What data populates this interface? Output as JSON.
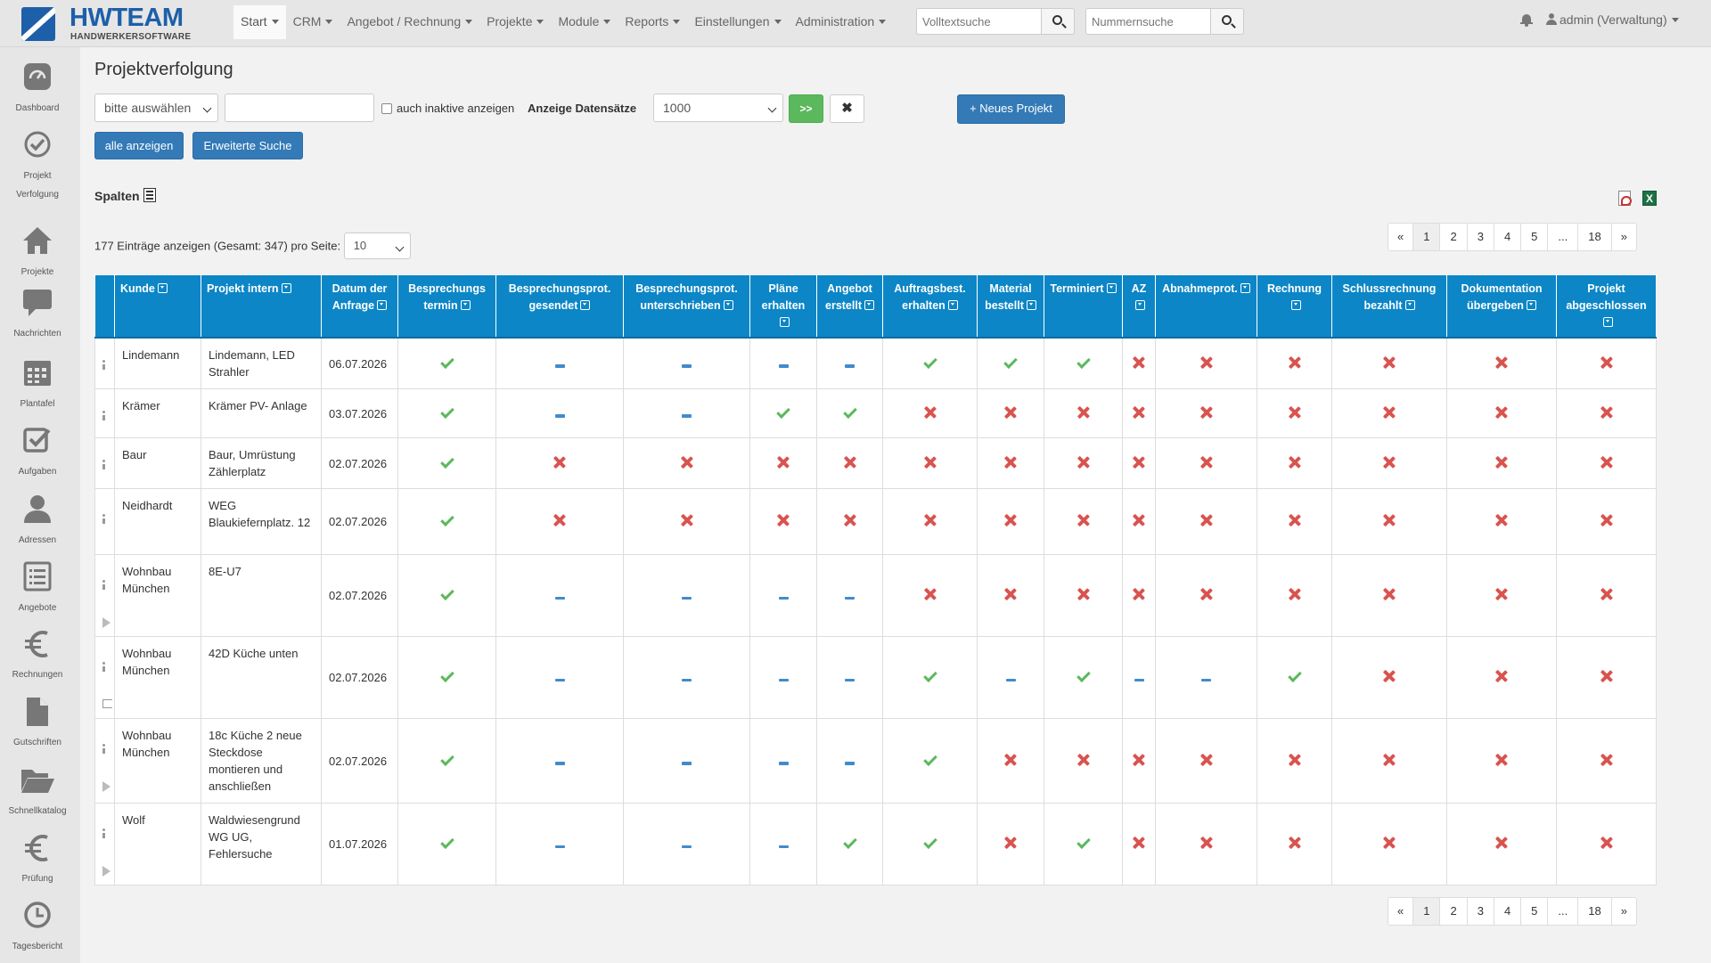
{
  "brand": {
    "name": "HWTEAM",
    "tagline": "HANDWERKERSOFTWARE"
  },
  "nav": [
    {
      "label": "Start",
      "active": true
    },
    {
      "label": "CRM"
    },
    {
      "label": "Angebot / Rechnung"
    },
    {
      "label": "Projekte"
    },
    {
      "label": "Module"
    },
    {
      "label": "Reports"
    },
    {
      "label": "Einstellungen"
    },
    {
      "label": "Administration"
    }
  ],
  "search": {
    "fulltext_placeholder": "Volltextsuche",
    "number_placeholder": "Nummernsuche"
  },
  "user": {
    "label": "admin (Verwaltung)"
  },
  "sidebar": [
    {
      "label": "Dashboard",
      "icon": "dashboard-icon"
    },
    {
      "label": "Projekt",
      "label2": "Verfolgung",
      "icon": "check-circle-icon"
    },
    {
      "label": "Projekte",
      "icon": "home-icon"
    },
    {
      "label": "Nachrichten",
      "icon": "comment-icon"
    },
    {
      "label": "Plantafel",
      "icon": "calendar-icon"
    },
    {
      "label": "Aufgaben",
      "icon": "checkbox-icon"
    },
    {
      "label": "Adressen",
      "icon": "user-icon"
    },
    {
      "label": "Angebote",
      "icon": "list-icon"
    },
    {
      "label": "Rechnungen",
      "icon": "euro-icon"
    },
    {
      "label": "Gutschriften",
      "icon": "file-icon"
    },
    {
      "label": "Schnellkatalog",
      "icon": "folder-open-icon"
    },
    {
      "label": "Prüfung",
      "icon": "euro-icon"
    },
    {
      "label": "Tagesbericht",
      "icon": "clock-icon"
    }
  ],
  "page": {
    "title": "Projektverfolgung",
    "filter_select": "bitte auswählen",
    "inactive_label": "auch inaktive anzeigen",
    "records_label": "Anzeige Datensätze",
    "records_value": "1000",
    "go_label": ">>",
    "clear_label": "✖",
    "new_project_label": "+ Neues Projekt",
    "show_all_label": "alle anzeigen",
    "advanced_search_label": "Erweiterte Suche",
    "columns_label": "Spalten",
    "entries_info": "177 Einträge anzeigen (Gesamt: 347) pro Seite:",
    "per_page": "10"
  },
  "pagination": [
    "«",
    "1",
    "2",
    "3",
    "4",
    "5",
    "...",
    "18",
    "»"
  ],
  "pagination_active": "1",
  "table": {
    "headers": [
      {
        "label": "Kunde",
        "align": "l"
      },
      {
        "label": "Projekt intern",
        "align": "l"
      },
      {
        "label": "Datum der Anfrage",
        "align": "c"
      },
      {
        "label": "Besprechungs termin",
        "align": "c"
      },
      {
        "label": "Besprechungsprot. gesendet",
        "align": "c"
      },
      {
        "label": "Besprechungsprot. unterschrieben",
        "align": "c"
      },
      {
        "label": "Pläne erhalten",
        "align": "c"
      },
      {
        "label": "Angebot erstellt",
        "align": "c"
      },
      {
        "label": "Auftragsbest. erhalten",
        "align": "c"
      },
      {
        "label": "Material bestellt",
        "align": "c"
      },
      {
        "label": "Terminiert",
        "align": "c"
      },
      {
        "label": "AZ",
        "align": "c"
      },
      {
        "label": "Abnahmeprot.",
        "align": "c"
      },
      {
        "label": "Rechnung",
        "align": "c"
      },
      {
        "label": "Schlussrechnung bezahlt",
        "align": "c"
      },
      {
        "label": "Dokumentation übergeben",
        "align": "c"
      },
      {
        "label": "Projekt abgeschlossen",
        "align": "c"
      }
    ],
    "rows": [
      {
        "kunde": "Lindemann",
        "projekt": "Lindemann, LED Strahler",
        "datum": "06.07.2026",
        "status": [
          "ok",
          "na",
          "na",
          "na",
          "na",
          "ok",
          "ok",
          "ok",
          "no",
          "no",
          "no",
          "no",
          "no",
          "no"
        ],
        "tools": [
          "info"
        ]
      },
      {
        "kunde": "Krämer",
        "projekt": "Krämer PV- Anlage",
        "datum": "03.07.2026",
        "status": [
          "ok",
          "na",
          "na",
          "ok",
          "ok",
          "no",
          "no",
          "no",
          "no",
          "no",
          "no",
          "no",
          "no",
          "no"
        ],
        "tools": [
          "info"
        ]
      },
      {
        "kunde": "Baur",
        "projekt": "Baur, Umrüstung Zählerplatz",
        "datum": "02.07.2026",
        "status": [
          "ok",
          "no",
          "no",
          "no",
          "no",
          "no",
          "no",
          "no",
          "no",
          "no",
          "no",
          "no",
          "no",
          "no"
        ],
        "tools": [
          "info"
        ]
      },
      {
        "kunde": "Neidhardt",
        "projekt": "WEG Blaukiefernplatz. 12",
        "datum": "02.07.2026",
        "status": [
          "ok",
          "no",
          "no",
          "no",
          "no",
          "no",
          "no",
          "no",
          "no",
          "no",
          "no",
          "no",
          "no",
          "no"
        ],
        "tools": [
          "info"
        ]
      },
      {
        "kunde": "Wohnbau München",
        "projekt": "8E-U7",
        "datum": "02.07.2026",
        "status": [
          "ok",
          "na",
          "na",
          "na",
          "na",
          "no",
          "no",
          "no",
          "no",
          "no",
          "no",
          "no",
          "no",
          "no"
        ],
        "tools": [
          "info",
          "play"
        ]
      },
      {
        "kunde": "Wohnbau München",
        "projekt": "42D Küche unten",
        "datum": "02.07.2026",
        "status": [
          "ok",
          "na",
          "na",
          "na",
          "na",
          "ok",
          "na",
          "ok",
          "na",
          "na",
          "ok",
          "no",
          "no",
          "no"
        ],
        "tools": [
          "info",
          "flag"
        ]
      },
      {
        "kunde": "Wohnbau München",
        "projekt": "18c Küche 2 neue Steckdose montieren und anschließen",
        "datum": "02.07.2026",
        "status": [
          "ok",
          "na",
          "na",
          "na",
          "na",
          "ok",
          "no",
          "no",
          "no",
          "no",
          "no",
          "no",
          "no",
          "no"
        ],
        "tools": [
          "info",
          "play"
        ]
      },
      {
        "kunde": "Wolf",
        "projekt": "Waldwiesengrund WG UG, Fehlersuche",
        "datum": "01.07.2026",
        "status": [
          "ok",
          "na",
          "na",
          "na",
          "ok",
          "ok",
          "no",
          "ok",
          "no",
          "no",
          "no",
          "no",
          "no",
          "no"
        ],
        "tools": [
          "info",
          "play"
        ]
      }
    ]
  }
}
